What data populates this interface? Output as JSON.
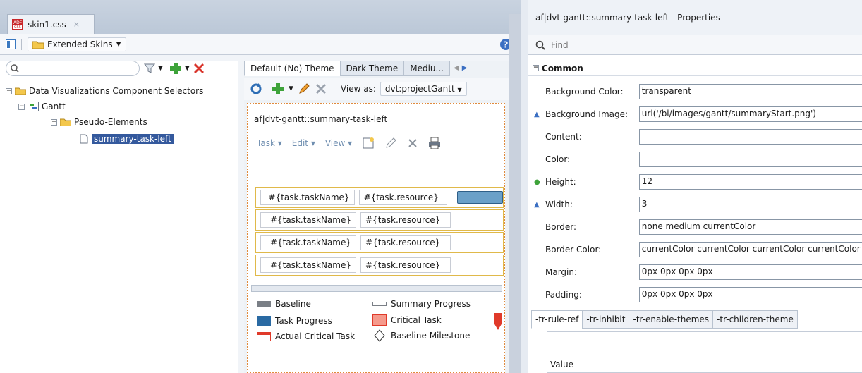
{
  "editor": {
    "file_tab": "skin1.css",
    "close_glyph": "×",
    "skin_selector": "Extended Skins",
    "search_placeholder": "",
    "tree": {
      "root": "Data Visualizations Component Selectors",
      "child": "Gantt",
      "grandchild": "Pseudo-Elements",
      "leaf": "summary-task-left"
    },
    "theme_tabs": [
      "Default (No) Theme",
      "Dark Theme",
      "Mediu..."
    ],
    "view_as_label": "View as:",
    "view_as_value": "dvt:projectGantt",
    "preview": {
      "selector": "af|dvt-gantt::summary-task-left",
      "menus": [
        "Task",
        "Edit",
        "View"
      ],
      "rows": [
        {
          "name": "#{task.taskName}",
          "resource": "#{task.resource}"
        },
        {
          "name": "#{task.taskName}",
          "resource": "#{task.resource}"
        },
        {
          "name": "#{task.taskName}",
          "resource": "#{task.resource}"
        },
        {
          "name": "#{task.taskName}",
          "resource": "#{task.resource}"
        }
      ],
      "legend": {
        "baseline": "Baseline",
        "summary_progress": "Summary Progress",
        "task_progress": "Task Progress",
        "critical_task": "Critical Task",
        "actual_critical_task": "Actual Critical Task",
        "baseline_milestone": "Baseline Milestone"
      }
    }
  },
  "properties": {
    "title": "af|dvt-gantt::summary-task-left - Properties",
    "find_placeholder": "Find",
    "section": "Common",
    "rows": [
      {
        "label": "Background Color:",
        "value": "transparent",
        "marker": ""
      },
      {
        "label": "Background Image:",
        "value": "url('/bi/images/gantt/summaryStart.png')",
        "marker": "arrow"
      },
      {
        "label": "Content:",
        "value": "",
        "marker": ""
      },
      {
        "label": "Color:",
        "value": "",
        "marker": ""
      },
      {
        "label": "Height:",
        "value": "12",
        "marker": "dot"
      },
      {
        "label": "Width:",
        "value": "3",
        "marker": "arrow"
      },
      {
        "label": "Border:",
        "value": "none medium currentColor",
        "marker": ""
      },
      {
        "label": "Border Color:",
        "value": "currentColor currentColor currentColor currentColor",
        "marker": ""
      },
      {
        "label": "Margin:",
        "value": "0px 0px 0px 0px",
        "marker": ""
      },
      {
        "label": "Padding:",
        "value": "0px 0px 0px 0px",
        "marker": ""
      }
    ],
    "tabs": [
      "-tr-rule-ref",
      "-tr-inhibit",
      "-tr-enable-themes",
      "-tr-children-theme"
    ],
    "table_header": "Value"
  },
  "colors": {
    "selection": "#34599d",
    "accent_orange": "#e08a3c",
    "gantt_border": "#e0b94a",
    "critical": "#e03a2a"
  }
}
